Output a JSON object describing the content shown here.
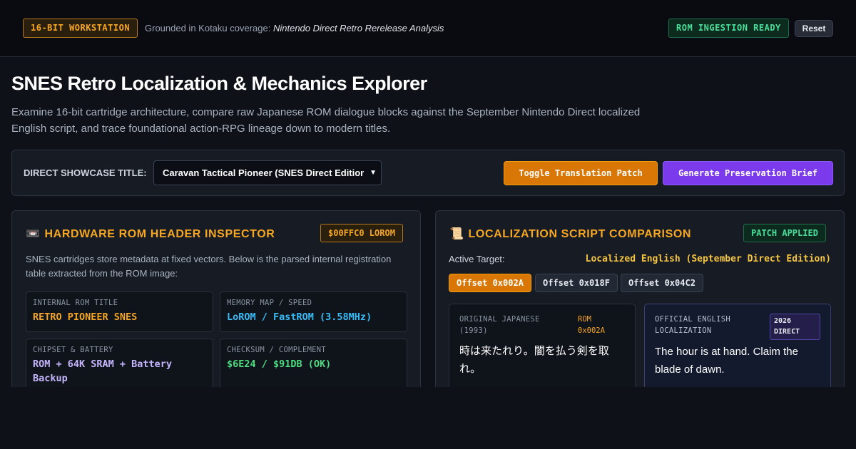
{
  "topbar": {
    "workstation_tag": "16-BIT WORKSTATION",
    "grounded_prefix": "Grounded in Kotaku coverage:",
    "grounded_source": "Nintendo Direct Retro Rerelease Analysis",
    "rom_status": "ROM INGESTION READY",
    "reset_label": "Reset"
  },
  "header": {
    "title": "SNES Retro Localization & Mechanics Explorer",
    "description": "Examine 16-bit cartridge architecture, compare raw Japanese ROM dialogue blocks against the September Nintendo Direct localized English script, and trace foundational action-RPG lineage down to modern titles."
  },
  "controls": {
    "showcase_label": "DIRECT SHOWCASE TITLE:",
    "showcase_selected": "Caravan Tactical Pioneer (SNES Direct Edition)",
    "toggle_patch_label": "Toggle Translation Patch",
    "generate_brief_label": "Generate Preservation Brief"
  },
  "rom_inspector": {
    "icon": "cartridge-icon",
    "title": "HARDWARE ROM HEADER INSPECTOR",
    "badge": "$00FFC0 LOROM",
    "description": "SNES cartridges store metadata at fixed vectors. Below is the parsed internal registration table extracted from the ROM image:",
    "fields": [
      {
        "label": "INTERNAL ROM TITLE",
        "value": "RETRO PIONEER SNES",
        "color": "#f5a623"
      },
      {
        "label": "MEMORY MAP / SPEED",
        "value": "LoROM / FastROM (3.58MHz)",
        "color": "#38bdf8"
      },
      {
        "label": "CHIPSET & BATTERY",
        "value": "ROM + 64K SRAM + Battery Backup",
        "color": "#c4b5fd"
      },
      {
        "label": "CHECKSUM / COMPLEMENT",
        "value": "$6E24 / $91DB (OK)",
        "color": "#4ade80"
      }
    ]
  },
  "localization": {
    "icon": "scroll-icon",
    "title": "LOCALIZATION SCRIPT COMPARISON",
    "badge": "PATCH APPLIED",
    "active_label": "Active Target:",
    "active_value": "Localized English (September Direct Edition)",
    "offsets": [
      {
        "label": "Offset 0x002A",
        "active": true
      },
      {
        "label": "Offset 0x018F",
        "active": false
      },
      {
        "label": "Offset 0x04C2",
        "active": false
      }
    ],
    "japanese_card": {
      "label": "ORIGINAL JAPANESE (1993)",
      "tag": "ROM 0x002A",
      "text": "時は来たれり。闇を払う剣を取れ。"
    },
    "english_card": {
      "label": "OFFICIAL ENGLISH LOCALIZATION",
      "tag": "2026 DIRECT",
      "text": "The hour is at hand. Claim the blade of dawn."
    }
  }
}
